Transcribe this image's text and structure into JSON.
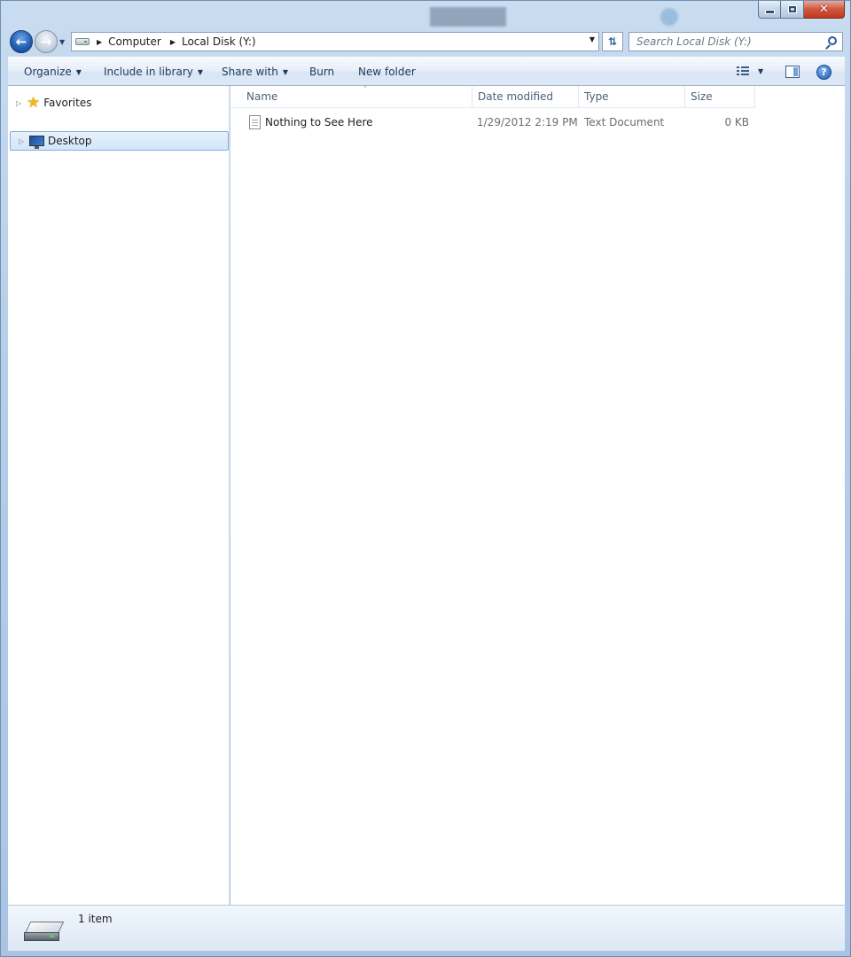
{
  "window": {
    "background_tabs": [
      "",
      "",
      "",
      "",
      ""
    ],
    "caption": {
      "minimize": "",
      "maximize": "",
      "close": "✕"
    }
  },
  "address_bar": {
    "breadcrumbs": [
      "Computer",
      "Local Disk (Y:)"
    ]
  },
  "search": {
    "placeholder": "Search Local Disk (Y:)"
  },
  "toolbar": {
    "organize": "Organize",
    "include_in_library": "Include in library",
    "share_with": "Share with",
    "burn": "Burn",
    "new_folder": "New folder"
  },
  "nav_pane": {
    "items": [
      {
        "label": "Favorites",
        "icon": "star-icon"
      },
      {
        "label": "Desktop",
        "icon": "desktop-icon",
        "selected": true
      }
    ]
  },
  "columns": {
    "name": "Name",
    "date_modified": "Date modified",
    "type": "Type",
    "size": "Size"
  },
  "files": [
    {
      "name": "Nothing to See Here",
      "date_modified": "1/29/2012 2:19 PM",
      "type": "Text Document",
      "size": "0 KB",
      "icon": "text-file-icon"
    }
  ],
  "status": {
    "item_count": "1 item"
  },
  "colors": {
    "accent": "#2361b7",
    "selection": "#d3e6fa",
    "close": "#c0391f"
  }
}
